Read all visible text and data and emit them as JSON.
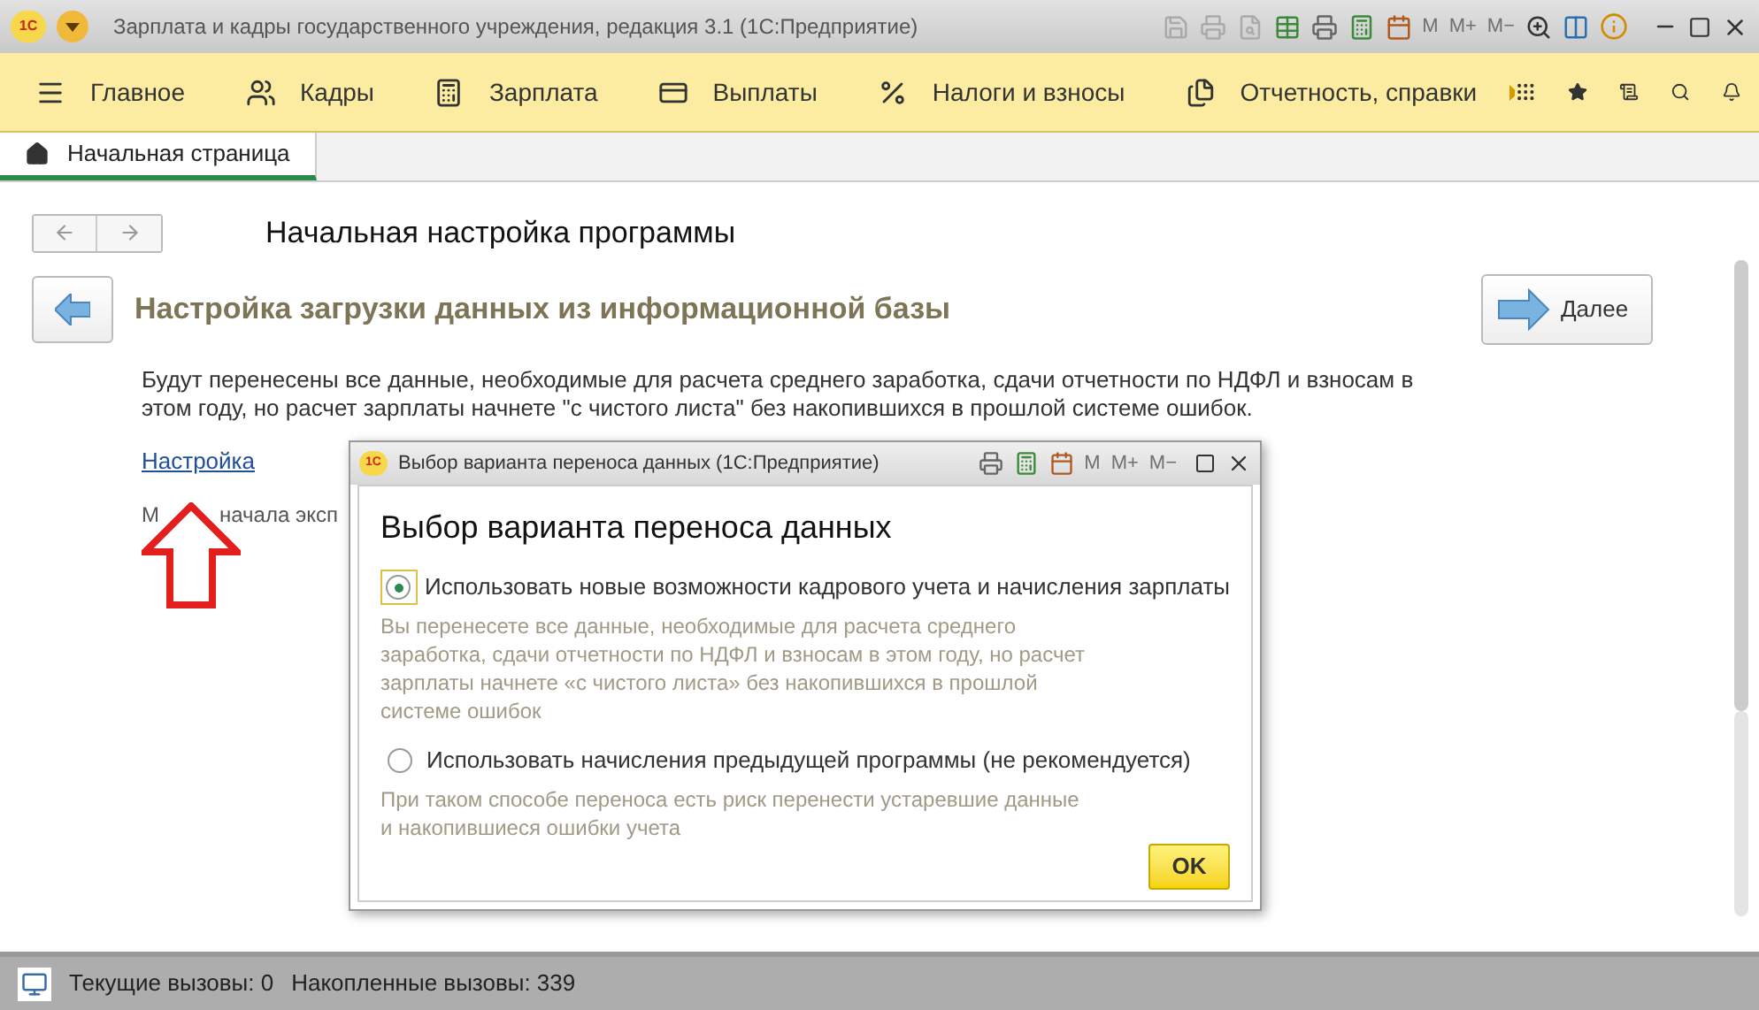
{
  "window": {
    "logo": "1С",
    "title": "Зарплата и кадры государственного учреждения, редакция 3.1  (1С:Предприятие)",
    "memory_buttons": [
      "M",
      "M+",
      "M−"
    ]
  },
  "menu": [
    {
      "label": "Главное"
    },
    {
      "label": "Кадры"
    },
    {
      "label": "Зарплата"
    },
    {
      "label": "Выплаты"
    },
    {
      "label": "Налоги и взносы"
    },
    {
      "label": "Отчетность, справки"
    }
  ],
  "tabs": [
    {
      "label": "Начальная страница",
      "selected": true
    }
  ],
  "page": {
    "title": "Начальная настройка программы",
    "step_title": "Настройка загрузки данных из информационной базы",
    "next_button": "Далее",
    "description": "Будут перенесены все данные, необходимые для расчета среднего заработка, сдачи отчетности по НДФЛ и взносам в этом году, но расчет зарплаты начнете \"с чистого листа\" без накопившихся в прошлой системе ошибок.",
    "link": "Настройка",
    "note": [
      "М",
      "начала эксп"
    ]
  },
  "dialog": {
    "logo": "1С",
    "title": "Выбор варианта переноса данных  (1С:Предприятие)",
    "memory_buttons": [
      "M",
      "M+",
      "M−"
    ],
    "heading": "Выбор варианта переноса данных",
    "options": [
      {
        "label": "Использовать новые возможности кадрового учета и начисления зарплаты",
        "hint": "Вы перенесете все данные, необходимые для расчета среднего заработка, сдачи отчетности по НДФЛ и взносам в этом году, но расчет зарплаты начнете «с чистого листа» без накопившихся в прошлой системе ошибок",
        "selected": true
      },
      {
        "label": "Использовать начисления предыдущей программы (не рекомендуется)",
        "hint": "При таком способе переноса есть риск перенести устаревшие данные и накопившиеся ошибки учета",
        "selected": false
      }
    ],
    "ok_button": "OK"
  },
  "status_bar": [
    "Текущие вызовы: 0",
    "Накопленные вызовы: 339"
  ]
}
